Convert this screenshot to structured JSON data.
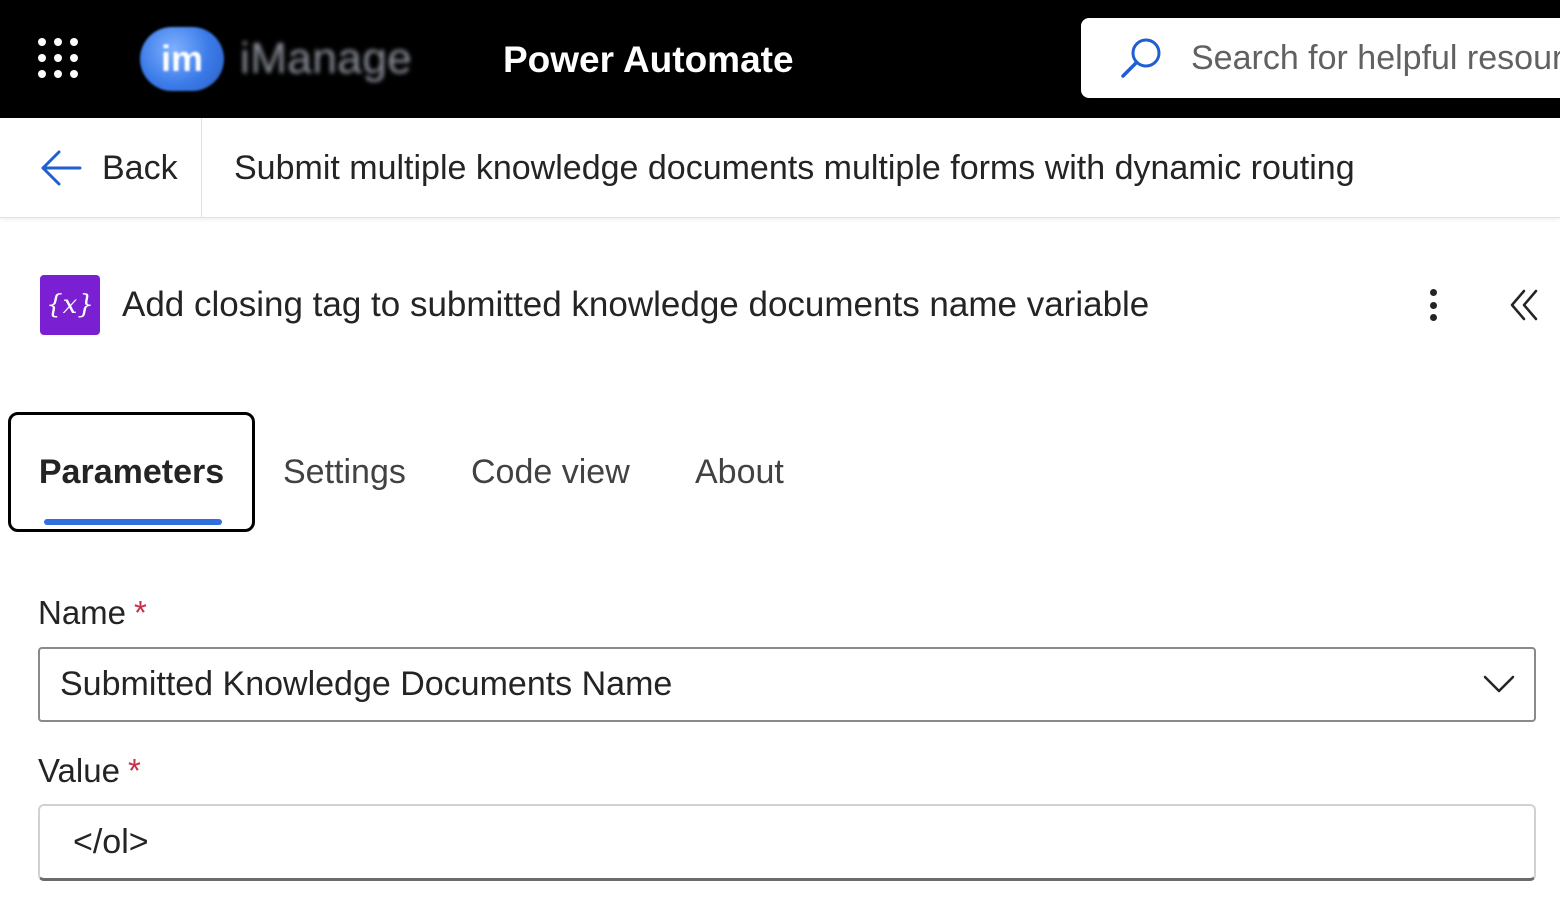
{
  "header": {
    "logo_text": "iManage",
    "logo_mark": "im",
    "app_title": "Power Automate",
    "search_placeholder": "Search for helpful resources",
    "icons": {
      "app_launcher": "waffle-icon",
      "search": "search-icon"
    }
  },
  "nav": {
    "back_label": "Back",
    "flow_title": "Submit multiple knowledge documents multiple forms with dynamic routing",
    "icons": {
      "back": "arrow-left-icon"
    }
  },
  "action": {
    "icon_glyph": "{x}",
    "icon_color": "#7a1fd1",
    "title": "Add closing tag to submitted knowledge documents name variable",
    "icons": {
      "more": "more-vertical-icon",
      "collapse": "chevron-double-left-icon"
    }
  },
  "tabs": [
    {
      "label": "Parameters",
      "active": true
    },
    {
      "label": "Settings",
      "active": false
    },
    {
      "label": "Code view",
      "active": false
    },
    {
      "label": "About",
      "active": false
    }
  ],
  "form": {
    "name_label": "Name",
    "name_value": "Submitted Knowledge Documents Name",
    "value_label": "Value",
    "value_value": "</ol>",
    "required_marker": "*"
  },
  "colors": {
    "topbar": "#000000",
    "accent": "#2f6fe0",
    "required": "#c4314b"
  }
}
